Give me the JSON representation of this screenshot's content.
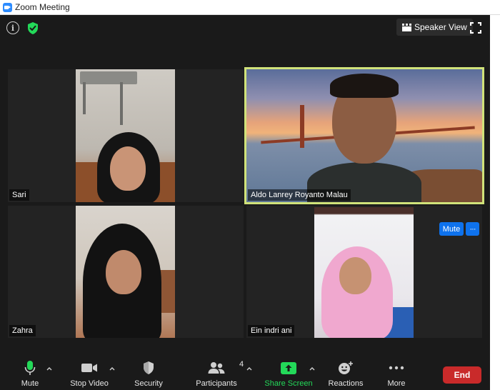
{
  "window": {
    "title": "Zoom Meeting"
  },
  "top_controls": {
    "speaker_view_label": "Speaker View"
  },
  "participants_tiles": [
    {
      "name": "Sari",
      "active_speaker": false
    },
    {
      "name": "Aldo Lanrey Royanto Malau",
      "active_speaker": true
    },
    {
      "name": "Zahra",
      "active_speaker": false
    },
    {
      "name": "Ein indri ani",
      "active_speaker": false
    }
  ],
  "tile_controls": {
    "mute_label": "Mute",
    "more_label": "···"
  },
  "toolbar": {
    "mute_label": "Mute",
    "stop_video_label": "Stop Video",
    "security_label": "Security",
    "participants_label": "Participants",
    "participants_count": "4",
    "share_screen_label": "Share Screen",
    "reactions_label": "Reactions",
    "more_label": "More",
    "end_label": "End"
  },
  "colors": {
    "accent_blue": "#0e72ed",
    "active_border": "#d1e37a",
    "share_green": "#23d959",
    "end_red": "#c92a2a",
    "shield_green": "#23d959"
  },
  "icons": [
    "zoom-logo-icon",
    "info-icon",
    "shield-check-icon",
    "speaker-view-icon",
    "fullscreen-icon",
    "microphone-icon",
    "video-camera-icon",
    "security-shield-icon",
    "participants-icon",
    "share-screen-icon",
    "reactions-icon",
    "more-dots-icon",
    "caret-up-icon"
  ]
}
